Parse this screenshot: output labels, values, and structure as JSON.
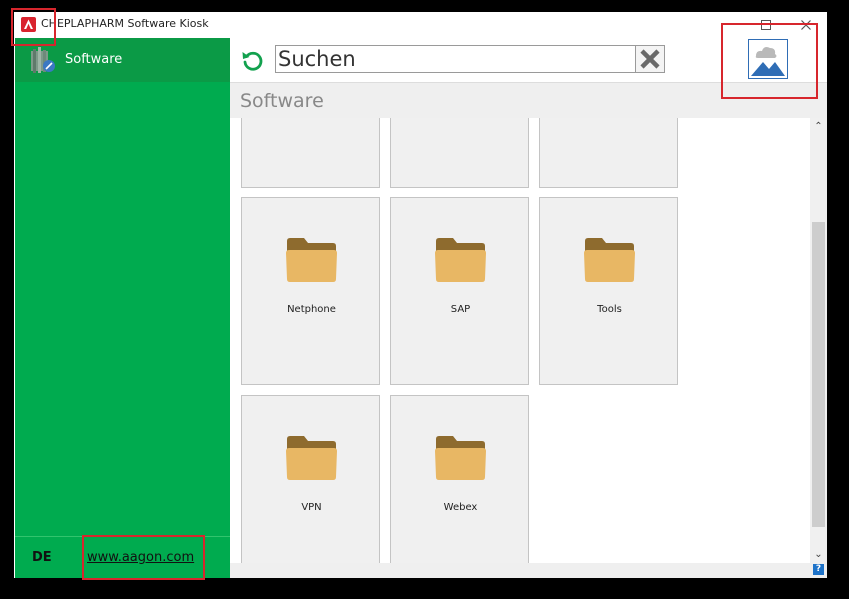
{
  "window": {
    "title": "CHEPLAPHARM Software Kiosk"
  },
  "sidebar": {
    "items": [
      {
        "label": "Software",
        "icon": "software-package-icon"
      }
    ],
    "language": "DE",
    "link": "www.aagon.com"
  },
  "search": {
    "value": "Suchen"
  },
  "section": {
    "title": "Software"
  },
  "tiles": [
    {
      "label": ""
    },
    {
      "label": ""
    },
    {
      "label": ""
    },
    {
      "label": "Netphone",
      "icon": "folder-icon"
    },
    {
      "label": "SAP",
      "icon": "folder-icon"
    },
    {
      "label": "Tools",
      "icon": "folder-icon"
    },
    {
      "label": "VPN",
      "icon": "folder-icon"
    },
    {
      "label": "Webex",
      "icon": "folder-icon"
    }
  ],
  "help": {
    "label": "?"
  },
  "colors": {
    "sidebar": "#00ab4f",
    "sidebar_selected": "#0b9a46",
    "folder": "#e8b764",
    "folder_back": "#8e6b2e",
    "annotation": "#d7262d",
    "picture_icon": "#2f6db5"
  }
}
